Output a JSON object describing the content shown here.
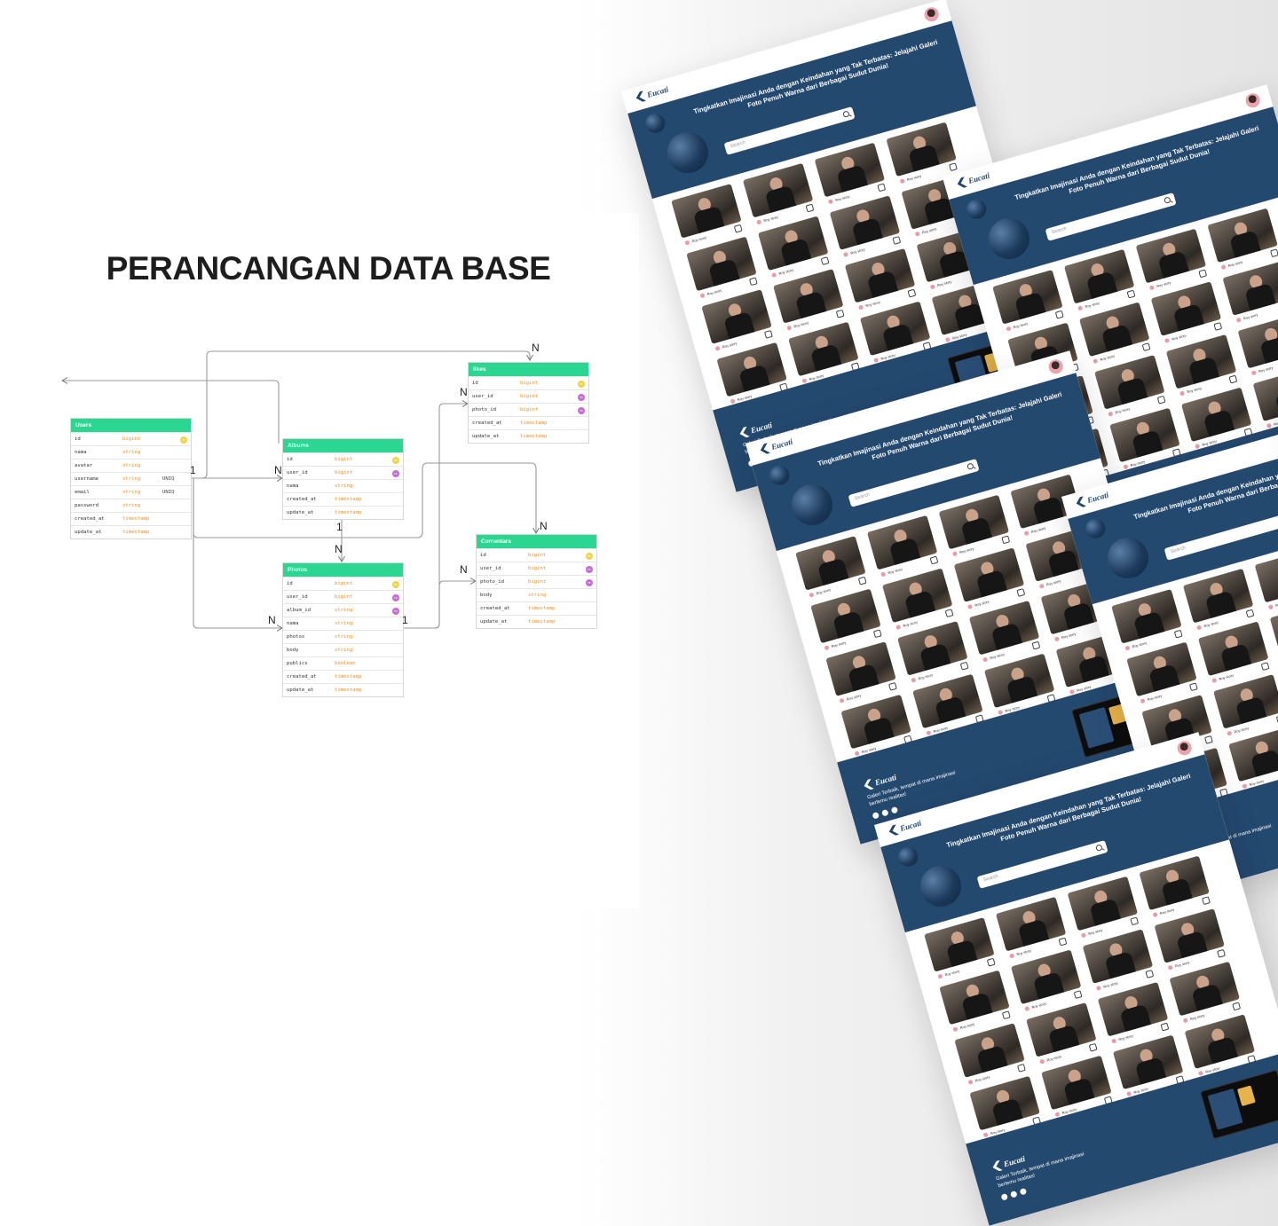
{
  "page_title": "PERANCANGAN DATA BASE",
  "erd": {
    "tables": [
      {
        "id": "users",
        "name": "Users",
        "columns": [
          {
            "name": "id",
            "type": "bigint",
            "key": "pk"
          },
          {
            "name": "nama",
            "type": "string"
          },
          {
            "name": "avatar",
            "type": "string"
          },
          {
            "name": "username",
            "type": "string",
            "extra": "UNIQ"
          },
          {
            "name": "email",
            "type": "string",
            "extra": "UNIQ"
          },
          {
            "name": "password",
            "type": "string"
          },
          {
            "name": "created_at",
            "type": "timestamp"
          },
          {
            "name": "update_at",
            "type": "timestamp"
          }
        ]
      },
      {
        "id": "albums",
        "name": "Albums",
        "columns": [
          {
            "name": "id",
            "type": "bigint",
            "key": "pk"
          },
          {
            "name": "user_id",
            "type": "bigint",
            "key": "fk"
          },
          {
            "name": "nama",
            "type": "string"
          },
          {
            "name": "created_at",
            "type": "timestamp"
          },
          {
            "name": "update_at",
            "type": "timestamp"
          }
        ]
      },
      {
        "id": "likes",
        "name": "likes",
        "columns": [
          {
            "name": "id",
            "type": "bigint",
            "key": "pk"
          },
          {
            "name": "user_id",
            "type": "bigint",
            "key": "fk"
          },
          {
            "name": "photo_id",
            "type": "bigint",
            "key": "fk"
          },
          {
            "name": "created_at",
            "type": "timestamp"
          },
          {
            "name": "update_at",
            "type": "timestamp"
          }
        ]
      },
      {
        "id": "photos",
        "name": "Photos",
        "columns": [
          {
            "name": "id",
            "type": "bigint",
            "key": "pk"
          },
          {
            "name": "user_id",
            "type": "bigint",
            "key": "fk"
          },
          {
            "name": "album_id",
            "type": "string",
            "key": "fk"
          },
          {
            "name": "nama",
            "type": "string"
          },
          {
            "name": "photos",
            "type": "string"
          },
          {
            "name": "body",
            "type": "string"
          },
          {
            "name": "publics",
            "type": "boolean"
          },
          {
            "name": "created_at",
            "type": "timestamp"
          },
          {
            "name": "update_at",
            "type": "timestamp"
          }
        ]
      },
      {
        "id": "comentars",
        "name": "Comentars",
        "columns": [
          {
            "name": "id",
            "type": "bigint",
            "key": "pk"
          },
          {
            "name": "user_id",
            "type": "bigint",
            "key": "fk"
          },
          {
            "name": "photo_id",
            "type": "bigint",
            "key": "fk"
          },
          {
            "name": "body",
            "type": "string"
          },
          {
            "name": "created_at",
            "type": "timestamp"
          },
          {
            "name": "update_at",
            "type": "timestamp"
          }
        ]
      }
    ],
    "key_labels": {
      "pk": "PK",
      "fk": "FK"
    },
    "cardinality": {
      "one": "1",
      "many": "N"
    }
  },
  "mockup": {
    "brand": "Eucati",
    "hero_title": "Tingkatkan Imajinasi Anda dengan Keindahan yang Tak Terbatas: Jelajahi Galeri Foto Penuh Warna dari Berbagai Sudut Dunia!",
    "search_placeholder": "Search",
    "card_user": "Roy story",
    "tagline": "Galeri Terbaik, tempat di mana imajinasi bertemu realitas!",
    "social_icons": [
      "facebook-icon",
      "instagram-icon",
      "youtube-icon"
    ]
  },
  "colors": {
    "table_header": "#2bd693",
    "type_text": "#f0901f",
    "pk_badge": "#f2d341",
    "fk_badge": "#c76ad8",
    "brand_navy": "#24496f"
  }
}
